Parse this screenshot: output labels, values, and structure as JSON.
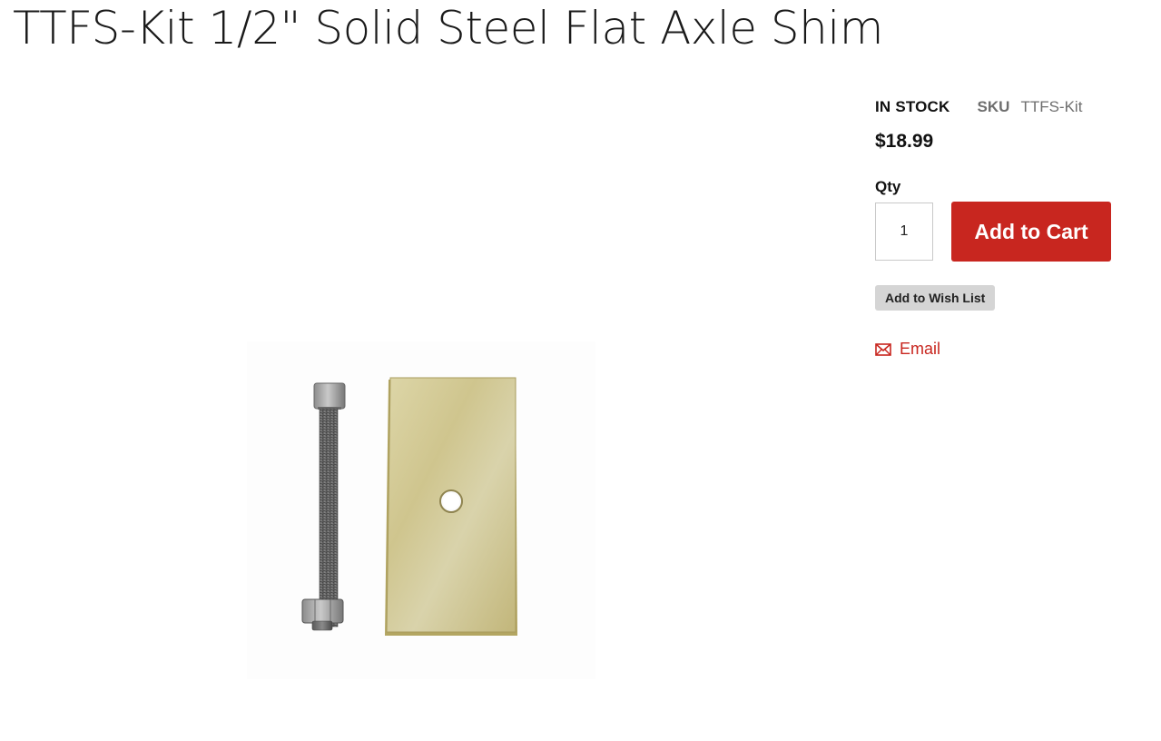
{
  "product": {
    "title": "TTFS-Kit 1/2\" Solid Steel Flat Axle Shim",
    "stock_status": "IN STOCK",
    "sku_label": "SKU",
    "sku_value": "TTFS-Kit",
    "price": "$18.99",
    "image_icon": "axle-shim-kit-photo"
  },
  "purchase": {
    "qty_label": "Qty",
    "qty_value": "1",
    "add_to_cart_label": "Add to Cart",
    "wishlist_label": "Add to Wish List",
    "email_label": "Email",
    "email_icon": "envelope-icon"
  },
  "colors": {
    "accent": "#c8261f",
    "muted_text": "#6e6e6e",
    "wishlist_bg": "#d5d5d5"
  }
}
